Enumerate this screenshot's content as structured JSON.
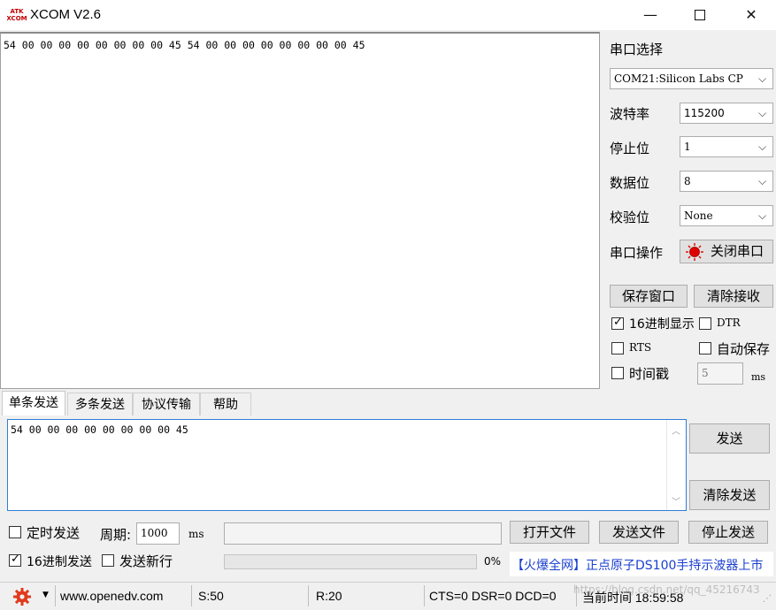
{
  "window": {
    "logo_text": "ATK\nXCOM",
    "title": "XCOM V2.6",
    "minimize_glyph": "—",
    "maximize_glyph": "☐",
    "close_glyph": "✕"
  },
  "receive": {
    "text": "54 00 00 00 00 00 00 00 00 45 54 00 00 00 00 00 00 00 00 45"
  },
  "serial": {
    "port_select_label": "串口选择",
    "port_value": "COM21:Silicon Labs CP",
    "baud_label": "波特率",
    "baud_value": "115200",
    "stop_label": "停止位",
    "stop_value": "1",
    "data_label": "数据位",
    "data_value": "8",
    "parity_label": "校验位",
    "parity_value": "None",
    "op_label": "串口操作",
    "op_button": "关闭串口",
    "led_color": "#e00000"
  },
  "rx_controls": {
    "save_window": "保存窗口",
    "clear_receive": "清除接收",
    "hex_display": "16进制显示",
    "hex_display_checked": true,
    "dtr": "DTR",
    "rts": "RTS",
    "auto_save": "自动保存",
    "timestamp": "时间戳",
    "timestamp_value": "5",
    "timestamp_unit": "ms"
  },
  "tabs": [
    "单条发送",
    "多条发送",
    "协议传输",
    "帮助"
  ],
  "send": {
    "text": "54 00 00 00 00 00 00 00 00 45",
    "send_button": "发送",
    "clear_send_button": "清除发送",
    "timed_send": "定时发送",
    "period_label": "周期:",
    "period_value": "1000",
    "period_unit": "ms",
    "open_file": "打开文件",
    "send_file": "发送文件",
    "stop_send": "停止发送",
    "hex_send": "16进制发送",
    "hex_send_checked": true,
    "send_newline": "发送新行",
    "progress_percent": "0%",
    "promo": "【火爆全网】正点原子DS100手持示波器上市"
  },
  "status": {
    "url": "www.openedv.com",
    "sent": "S:50",
    "received": "R:20",
    "lines": "CTS=0 DSR=0 DCD=0",
    "time": "当前时间 18:59:58",
    "watermark": "https://blog.csdn.net/qq_45216743"
  }
}
